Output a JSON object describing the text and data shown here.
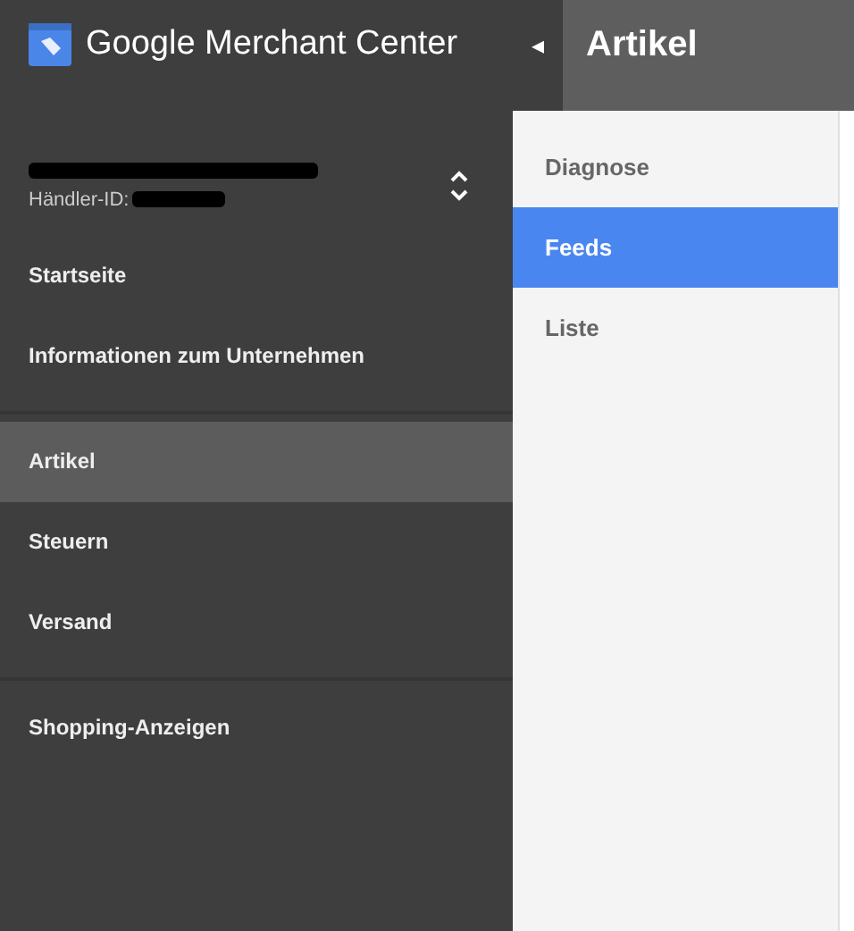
{
  "sidebar": {
    "logo_text": "Google Merchant Center",
    "account": {
      "merchant_id_label": "Händler-ID:"
    },
    "groups": [
      {
        "items": [
          {
            "label": "Startseite",
            "selected": false
          },
          {
            "label": "Informationen zum Unternehmen",
            "selected": false
          }
        ]
      },
      {
        "items": [
          {
            "label": "Artikel",
            "selected": true
          },
          {
            "label": "Steuern",
            "selected": false
          },
          {
            "label": "Versand",
            "selected": false
          }
        ]
      },
      {
        "items": [
          {
            "label": "Shopping-Anzeigen",
            "selected": false
          }
        ]
      }
    ]
  },
  "header": {
    "collapse_icon": "◂",
    "title": "Artikel"
  },
  "submenu": {
    "items": [
      {
        "label": "Diagnose",
        "selected": false
      },
      {
        "label": "Feeds",
        "selected": true
      },
      {
        "label": "Liste",
        "selected": false
      }
    ]
  }
}
